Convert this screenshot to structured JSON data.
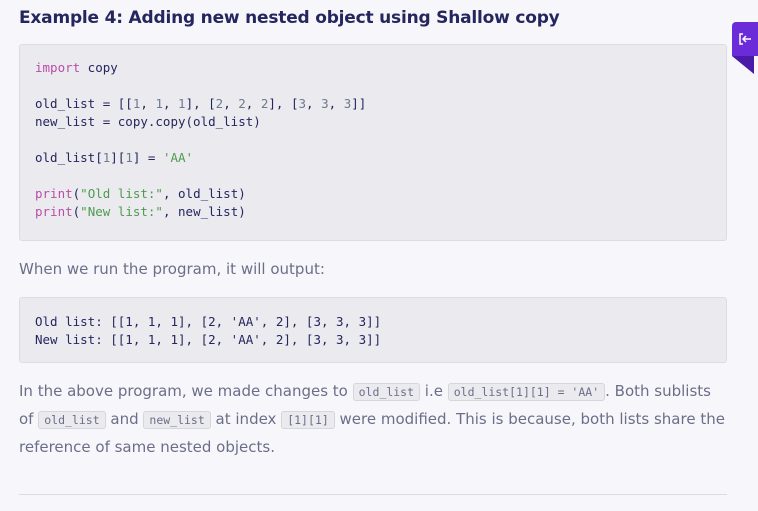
{
  "heading": "Example 4: Adding new nested object using Shallow copy",
  "code": {
    "l1_kw": "import",
    "l1_rest": " copy",
    "l2_a": "old_list = [[",
    "l2_n1": "1",
    "l2_n2": "1",
    "l2_n3": "1",
    "l2_n4": "2",
    "l2_n5": "2",
    "l2_n6": "2",
    "l2_n7": "3",
    "l2_n8": "3",
    "l2_n9": "3",
    "l3": "new_list = copy.copy(old_list)",
    "l4_a": "old_list[",
    "l4_n1": "1",
    "l4_n2": "1",
    "l4_b": "] = ",
    "l4_str": "'AA'",
    "l5_fn": "print",
    "l5_str": "\"Old list:\"",
    "l5_rest": ", old_list)",
    "l6_fn": "print",
    "l6_str": "\"New list:\"",
    "l6_rest": ", new_list)"
  },
  "run_text": "When we run the program, it will output:",
  "output": {
    "line1": "Old list: [[1, 1, 1], [2, 'AA', 2], [3, 3, 3]]",
    "line2": "New list: [[1, 1, 1], [2, 'AA', 2], [3, 3, 3]]"
  },
  "explain": {
    "t1": "In the above program, we made changes to ",
    "c1": "old_list",
    "t2": " i.e ",
    "c2": "old_list[1][1] = 'AA'",
    "t3": ". Both sublists of ",
    "c3": "old_list",
    "t4": " and ",
    "c4": "new_list",
    "t5": " at index ",
    "c5": "[1][1]",
    "t6": " were modified. This is because, both lists share the reference of same nested objects."
  },
  "side_tab_icon": "exit-arrow-icon",
  "colors": {
    "heading": "#25265e",
    "accent": "#6b2bd9",
    "keyword": "#b84ea8",
    "string": "#4e9a4e"
  }
}
